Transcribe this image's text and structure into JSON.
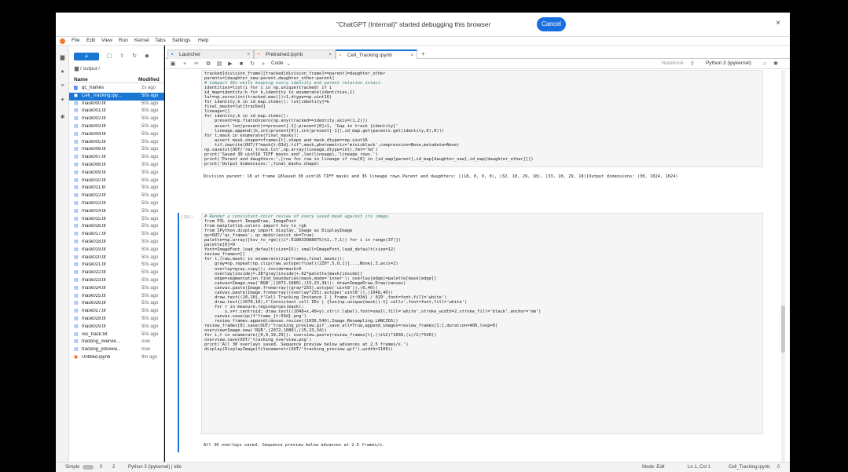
{
  "browser": {
    "debug_message": "\"ChatGPT (Internal)\" started debugging this browser",
    "cancel_label": "Cancel",
    "close_symbol": "×"
  },
  "menu": [
    "File",
    "Edit",
    "View",
    "Run",
    "Kernel",
    "Tabs",
    "Settings",
    "Help"
  ],
  "filebrowser": {
    "new_label": "+",
    "path": "/ output /",
    "col_name": "Name",
    "col_modified": "Modified",
    "files": [
      {
        "name": "qc_frames",
        "mod": "2s ago",
        "icon": "folder-icon",
        "sel": false
      },
      {
        "name": "Cell_Tracking.ipy...",
        "mod": "50s ago",
        "icon": "notebook-icon",
        "sel": true
      },
      {
        "name": "mask000.tif",
        "mod": "50s ago",
        "icon": "file-icon",
        "sel": false
      },
      {
        "name": "mask001.tif",
        "mod": "50s ago",
        "icon": "file-icon",
        "sel": false
      },
      {
        "name": "mask002.tif",
        "mod": "50s ago",
        "icon": "file-icon",
        "sel": false
      },
      {
        "name": "mask003.tif",
        "mod": "50s ago",
        "icon": "file-icon",
        "sel": false
      },
      {
        "name": "mask004.tif",
        "mod": "50s ago",
        "icon": "file-icon",
        "sel": false
      },
      {
        "name": "mask005.tif",
        "mod": "50s ago",
        "icon": "file-icon",
        "sel": false
      },
      {
        "name": "mask006.tif",
        "mod": "50s ago",
        "icon": "file-icon",
        "sel": false
      },
      {
        "name": "mask007.tif",
        "mod": "50s ago",
        "icon": "file-icon",
        "sel": false
      },
      {
        "name": "mask008.tif",
        "mod": "50s ago",
        "icon": "file-icon",
        "sel": false
      },
      {
        "name": "mask009.tif",
        "mod": "50s ago",
        "icon": "file-icon",
        "sel": false
      },
      {
        "name": "mask010.tif",
        "mod": "50s ago",
        "icon": "file-icon",
        "sel": false
      },
      {
        "name": "mask011.tif",
        "mod": "50s ago",
        "icon": "file-icon",
        "sel": false
      },
      {
        "name": "mask012.tif",
        "mod": "50s ago",
        "icon": "file-icon",
        "sel": false
      },
      {
        "name": "mask013.tif",
        "mod": "50s ago",
        "icon": "file-icon",
        "sel": false
      },
      {
        "name": "mask014.tif",
        "mod": "50s ago",
        "icon": "file-icon",
        "sel": false
      },
      {
        "name": "mask015.tif",
        "mod": "50s ago",
        "icon": "file-icon",
        "sel": false
      },
      {
        "name": "mask016.tif",
        "mod": "50s ago",
        "icon": "file-icon",
        "sel": false
      },
      {
        "name": "mask017.tif",
        "mod": "50s ago",
        "icon": "file-icon",
        "sel": false
      },
      {
        "name": "mask018.tif",
        "mod": "50s ago",
        "icon": "file-icon",
        "sel": false
      },
      {
        "name": "mask019.tif",
        "mod": "50s ago",
        "icon": "file-icon",
        "sel": false
      },
      {
        "name": "mask020.tif",
        "mod": "50s ago",
        "icon": "file-icon",
        "sel": false
      },
      {
        "name": "mask021.tif",
        "mod": "50s ago",
        "icon": "file-icon",
        "sel": false
      },
      {
        "name": "mask022.tif",
        "mod": "50s ago",
        "icon": "file-icon",
        "sel": false
      },
      {
        "name": "mask023.tif",
        "mod": "50s ago",
        "icon": "file-icon",
        "sel": false
      },
      {
        "name": "mask024.tif",
        "mod": "50s ago",
        "icon": "file-icon",
        "sel": false
      },
      {
        "name": "mask025.tif",
        "mod": "50s ago",
        "icon": "file-icon",
        "sel": false
      },
      {
        "name": "mask026.tif",
        "mod": "50s ago",
        "icon": "file-icon",
        "sel": false
      },
      {
        "name": "mask027.tif",
        "mod": "50s ago",
        "icon": "file-icon",
        "sel": false
      },
      {
        "name": "mask028.tif",
        "mod": "50s ago",
        "icon": "file-icon",
        "sel": false
      },
      {
        "name": "mask029.tif",
        "mod": "50s ago",
        "icon": "file-icon",
        "sel": false
      },
      {
        "name": "res_track.txt",
        "mod": "50s ago",
        "icon": "file-icon",
        "sel": false
      },
      {
        "name": "tracking_overvie...",
        "mod": "now",
        "icon": "file-icon",
        "sel": false
      },
      {
        "name": "tracking_preview...",
        "mod": "now",
        "icon": "file-icon",
        "sel": false
      },
      {
        "name": "Untitled.ipynb",
        "mod": "9m ago",
        "icon": "notebook-icon",
        "sel": false
      }
    ]
  },
  "tabs": [
    {
      "label": "Launcher",
      "active": false
    },
    {
      "label": "Pretrained.ipynb",
      "active": false
    },
    {
      "label": "Cell_Tracking.ipynb",
      "active": true
    }
  ],
  "toolbar": {
    "cell_type": "Code",
    "notebook_mode": "Notebook",
    "kernel": "Python 3 (ipykernel)"
  },
  "cells": {
    "cell1_code": [
      "tracked[division_frame][tracked[division_frame]==parent]=daughter_other",
      "parents=[daughter_new:parent,daughter_other:parent]",
      "# Compact IDs while keeping every identity and parent relation intact.",
      "identities=list(i for i in np.unique(tracked) if i",
      "id_map=identity:k for k,identity in enumerate(identities,1)",
      "lut=np.zeros(int(tracked.max())+1,dtype=np.uint16)",
      "for identity,k in id_map.items(): lut[identity]=k",
      "final_masks=lut[tracked]",
      "lineage=[]",
      "for identity,k in id_map.items():",
      "    present=np.flatnonzero(np.any(tracked==identity,axis=(1,2)))",
      "    assert len(present)==present[-1]-present[0]+1, 'Gap in track {identity}'",
      "    lineage.append((k,int(present[0]),int(present[-1]),id_map.get(parents.get(identity,0),0)))",
      "for t,mask in enumerate(final_masks):",
      "    assert mask.shape==frames[t].shape and mask.dtype==np.uint16",
      "    tif.imwrite(OUT/f\"mask{t:03d}.tif\",mask,photometric='minisblack',compression=None,metadata=None)",
      "np.savetxt(OUT/'res_track.txt',np.array(lineage,dtype=int),fmt='%d')",
      "print('Saved 30 uint16 TIFF masks and',len(lineage),'lineage rows.')",
      "print('Parent and daughters:',[row for row in lineage if row[0] in [id_map[parent],id_map[daughter_new],id_map[daughter_other]]])",
      "print('Output dimensions:',final_masks.shape)"
    ],
    "cell1_output": [
      "Division parent: 18 at frame 18",
      "Saved 30 uint16 TIFF masks and 36 lineage rows.",
      "Parent and daughters: [(18, 0, 9, 0), (32, 10, 29, 18), (33, 10, 29, 18)]",
      "Output dimensions: (30, 1024, 1024)"
    ],
    "cell2_prompt": "[16]:",
    "cell2_code": [
      "# Render a consistent-color review of every saved mask against its image.",
      "from PIL import ImageDraw, ImageFont",
      "from matplotlib.colors import hsv_to_rgb",
      "from IPython.display import display, Image as DisplayImage",
      "qc=OUT/'qc_frames'; qc.mkdir(exist_ok=True)",
      "palette=np.array([hsv_to_rgb(((i*.618033988075)%1,.7,1)) for i in range(37)])",
      "palette[0]=0",
      "font=ImageFont.load_default(size=15); small=ImageFont.load_default(size=12)",
      "review_frames=[]",
      "for t,(raw,mask) in enumerate(zip(frames,final_masks)):",
      "    gray=np.repeat(np.clip(raw.astype(float)/220*.5,0,1)[...,None],3,axis=2)",
      "    overlay=gray.copy(); inside=mask>0",
      "    overlay[inside]=.38*gray[inside]+.62*palette[mask[inside]]",
      "    edge=segmentation.find_boundaries(mask,mode='inner'); overlay[edge]=palette[mask[edge]]",
      "    canvas=Image.new('RGB',(2072,1080),(15,23,34)); draw=ImageDraw.Draw(canvas)",
      "    canvas.paste(Image.fromarray((gray*255).astype('uint8')),(0,40))",
      "    canvas.paste(Image.fromarray((overlay*255).astype('uint8')),(1048,40))",
      "    draw.text((20,10),f'Cell Tracking Instance 1 | Frame {t:03d} / 029',font=font,fill='white')",
      "    draw.text((1070,10),f'Consistent cell IDs | {len(np.unique(mask))-1} cells',font=font,fill='white')",
      "    for r in measure.regionprops(mask):",
      "        y,x=r.centroid; draw.text((1048+x,40+y),str(r.label),font=small,fill='white',stroke_width=2,stroke_fill='black',anchor='mm')",
      "    canvas.save(qc/f'frame_{t:03d}.png')",
      "    review_frames.append(canvas.resize((1036,540),Image.Resampling.LANCZOS))",
      "review_frames[0].save(OUT/'tracking_preview.gif',save_all=True,append_images=review_frames[1:],duration=400,loop=0)",
      "overview=Image.new('RGB',(2072,1080),(15,23,34))",
      "for i,t in enumerate([0,9,19,29]): overview.paste(review_frames[t],((i%2)*1036,(i//2)*540))",
      "overview.save(OUT/'tracking_overview.png')",
      "print('All 30 overlays saved. Sequence preview below advances at 2.5 frames/s.')",
      "display(DisplayImage(filename=str(OUT/'tracking_preview.gif'),width=1100))"
    ],
    "cell2_output": "All 30 overlays saved. Sequence preview below advances at 2.5 frames/s."
  },
  "statusbar": {
    "mode": "Simple",
    "counts": "0",
    "counts2": "2",
    "kernel_status": "Python 3 (ipykernel) | Idle",
    "edit_mode": "Mode: Edit",
    "cursor": "Ln 1, Col 1",
    "filename": "Cell_Tracking.ipynb",
    "bell": "0"
  }
}
